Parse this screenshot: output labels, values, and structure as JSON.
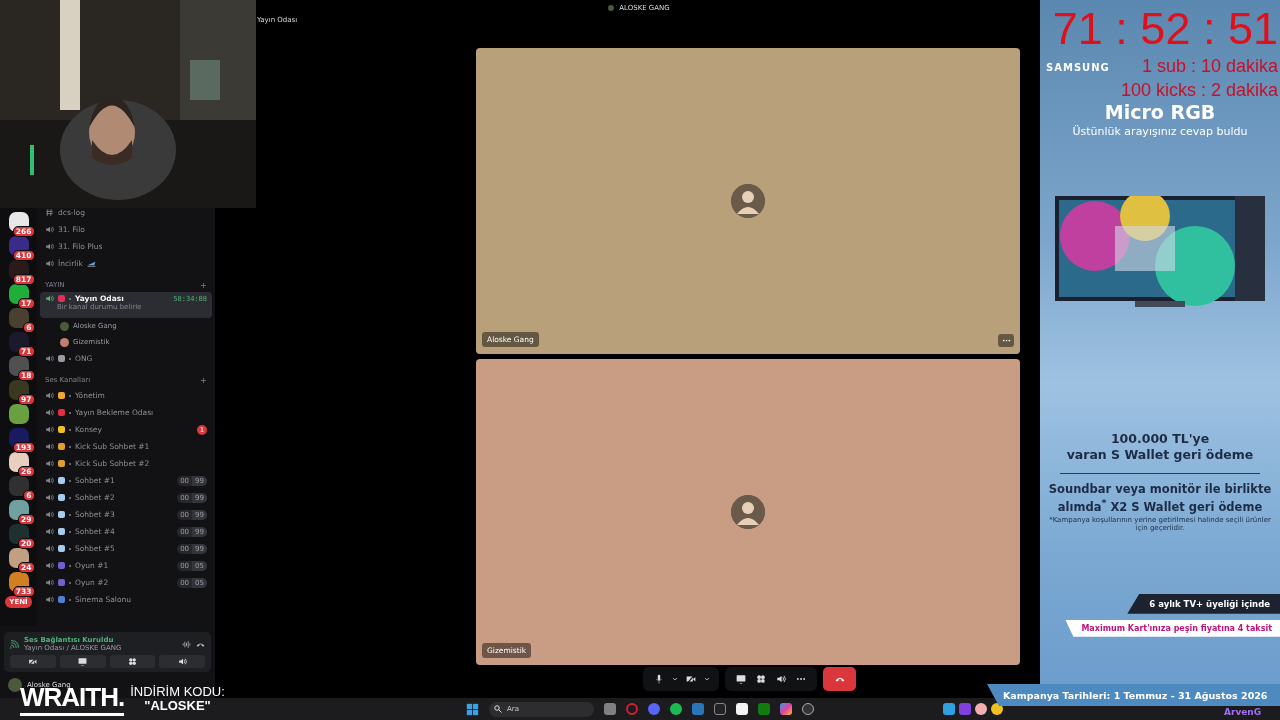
{
  "servers": [
    {
      "color": "#e8e8e8",
      "badge": "266"
    },
    {
      "color": "#3a2a8a",
      "badge": "410"
    },
    {
      "color": "#2a1a1a",
      "badge": "817"
    },
    {
      "color": "#1fae3a",
      "badge": "17"
    },
    {
      "color": "#4a4030",
      "badge": "6"
    },
    {
      "color": "#1a1a2a",
      "badge": "71"
    },
    {
      "color": "#505050",
      "badge": "18"
    },
    {
      "color": "#3a3820",
      "badge": "97"
    },
    {
      "color": "#6aa040"
    },
    {
      "color": "#1a1a60",
      "badge": "193"
    },
    {
      "color": "#e8d0c0",
      "badge": "26"
    },
    {
      "color": "#303030",
      "badge": "6"
    },
    {
      "color": "#70a0a0",
      "badge": "29"
    },
    {
      "color": "#203030",
      "badge": "20"
    },
    {
      "color": "#c0a080",
      "badge": "24"
    },
    {
      "color": "#d08020",
      "badge": "733"
    },
    {
      "color": "#da373c",
      "badge": "YENİ",
      "kind": "new"
    }
  ],
  "channels": [
    {
      "kind": "text",
      "name": "dcs-log",
      "selected": false
    },
    {
      "kind": "voice",
      "name": "31. Filo",
      "selected": false
    },
    {
      "kind": "voice",
      "name": "31. Filo Plus",
      "selected": false
    },
    {
      "kind": "voice",
      "name": "İncirlik",
      "selected": false
    },
    {
      "kind": "category",
      "name": "YAYIN"
    },
    {
      "kind": "voice",
      "name": "Yayın Odası",
      "color": "#e0305a",
      "selected": true,
      "status": "Bir kanal durumu belirle",
      "timer": "58:34:08",
      "children": [
        {
          "name": "Aloske Gang",
          "color": "#4a5a3a"
        },
        {
          "name": "Gizemistik",
          "color": "#c08070"
        }
      ]
    },
    {
      "kind": "voice",
      "name": "ONG",
      "color": "#9a9aa0",
      "selected": false
    },
    {
      "kind": "category",
      "name": "Ses Kanalları"
    },
    {
      "kind": "voice",
      "name": "Yönetim",
      "color": "#f0a830",
      "selected": false
    },
    {
      "kind": "voice",
      "name": "Yayın Bekleme Odası",
      "color": "#e03040",
      "selected": false
    },
    {
      "kind": "voice",
      "name": "Konsey",
      "color": "#f0c020",
      "selected": false,
      "mentions": "1"
    },
    {
      "kind": "voice",
      "name": "Kick Sub Sohbet #1",
      "color": "#e0a030",
      "selected": false
    },
    {
      "kind": "voice",
      "name": "Kick Sub Sohbet #2",
      "color": "#e0a030",
      "selected": false
    },
    {
      "kind": "voice",
      "name": "Sohbet #1",
      "color": "#a8ccf0",
      "selected": false,
      "users": "00",
      "limit": "99"
    },
    {
      "kind": "voice",
      "name": "Sohbet #2",
      "color": "#a8ccf0",
      "selected": false,
      "users": "00",
      "limit": "99"
    },
    {
      "kind": "voice",
      "name": "Sohbet #3",
      "color": "#a8ccf0",
      "selected": false,
      "users": "00",
      "limit": "99"
    },
    {
      "kind": "voice",
      "name": "Sohbet #4",
      "color": "#a8ccf0",
      "selected": false,
      "users": "00",
      "limit": "99"
    },
    {
      "kind": "voice",
      "name": "Sohbet #5",
      "color": "#a8ccf0",
      "selected": false,
      "users": "00",
      "limit": "99"
    },
    {
      "kind": "voice",
      "name": "Oyun #1",
      "color": "#7060d0",
      "selected": false,
      "users": "00",
      "limit": "05"
    },
    {
      "kind": "voice",
      "name": "Oyun #2",
      "color": "#7060d0",
      "selected": false,
      "users": "00",
      "limit": "05"
    },
    {
      "kind": "voice",
      "name": "Sinema Salonu",
      "color": "#5080d0",
      "selected": false
    }
  ],
  "voice_panel": {
    "title": "Ses Bağlantısı Kuruldu",
    "subtitle": "Yayın Odası / ALOSKE GANG"
  },
  "user_panel": {
    "name": "Aloske Gang"
  },
  "promo": {
    "brand": "WRAITH.",
    "label": "İNDİRİM KODU:",
    "code": "\"ALOSKE\""
  },
  "call": {
    "server": "ALOSKE GANG",
    "channel": "Yayın Odası",
    "tiles": [
      {
        "name": "Aloske Gang",
        "color": "#b8a07a",
        "menu": true
      },
      {
        "name": "Gizemistik",
        "color": "#c99c84",
        "menu": false
      }
    ]
  },
  "timer": {
    "time": "71 : 52 : 51",
    "lines": [
      "1 sub : 10 dakika",
      "100 kicks : 2 dakika"
    ]
  },
  "ad": {
    "brand": "SAMSUNG",
    "title": "Micro RGB",
    "subtitle": "Üstünlük arayışınız cevap buldu",
    "offer_1": "100.000 TL'ye",
    "offer_2": "varan S Wallet geri ödeme",
    "offer_3": "Soundbar veya monitör ile birlikte alımda$^{*}$ X2 S Wallet geri ödeme",
    "fine_print": "*Kampanya koşullarının yerine getirilmesi halinde seçili ürünler için geçerlidir.",
    "tv_plus": "6 aylık TV+ üyeliği içinde",
    "card": "Maximum Kart'ınıza peşin fiyatına 4 taksit",
    "dates": "Kampanya Tarihleri: 1 Temmuz - 31 Ağustos 2026"
  },
  "taskbar": {
    "search_placeholder": "Ara",
    "user": "ArvenG"
  }
}
